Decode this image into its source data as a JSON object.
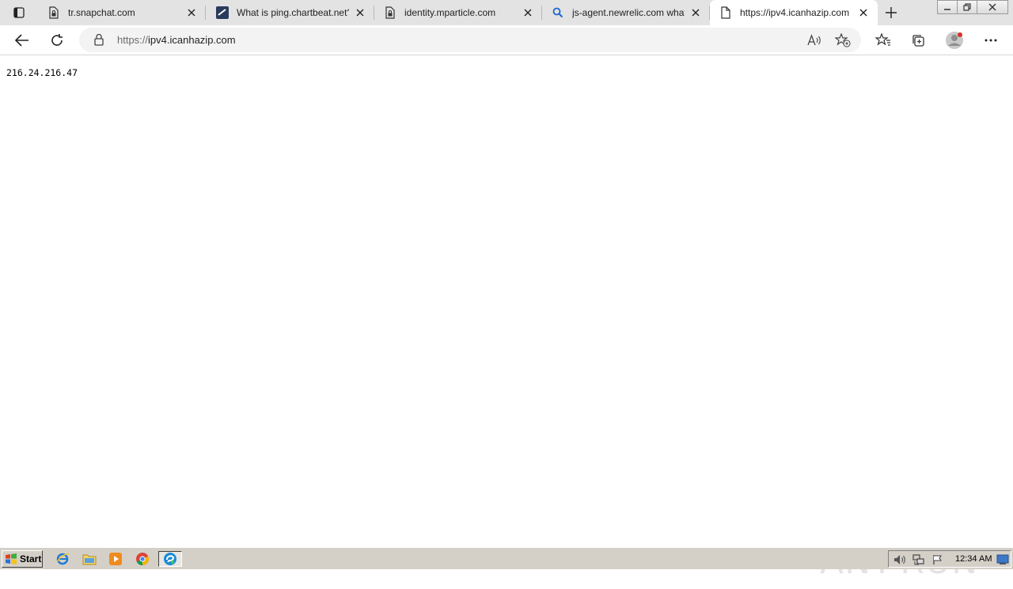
{
  "tabs": [
    {
      "title": "tr.snapchat.com",
      "favicon": "page-lock-icon"
    },
    {
      "title": "What is ping.chartbeat.net?",
      "favicon": "chartbeat-logo-icon"
    },
    {
      "title": "identity.mparticle.com",
      "favicon": "page-lock-icon"
    },
    {
      "title": "js-agent.newrelic.com what",
      "favicon": "search-icon"
    },
    {
      "title": "https://ipv4.icanhazip.com",
      "favicon": "page-icon"
    }
  ],
  "address_bar": {
    "scheme": "https://",
    "host": "ipv4.icanhazip.com"
  },
  "page": {
    "ip_address": "216.24.216.47"
  },
  "watermark": {
    "text_left": "ANY",
    "text_right": "RUN"
  },
  "taskbar": {
    "start_label": "Start",
    "clock": "12:34 AM"
  },
  "colors": {
    "tabstrip_bg": "#e3e3e3",
    "address_bg": "#f3f3f3",
    "taskbar_bg": "#d4d0c8",
    "accent_blue": "#0a5bbf"
  }
}
